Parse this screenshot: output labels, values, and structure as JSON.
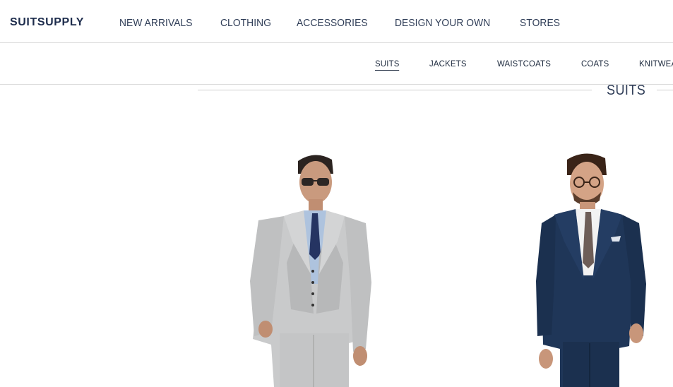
{
  "header": {
    "logo": "SUITSUPPLY",
    "nav": [
      "NEW ARRIVALS",
      "CLOTHING",
      "ACCESSORIES",
      "DESIGN YOUR OWN",
      "STORES"
    ]
  },
  "subnav": {
    "items": [
      "SUITS",
      "JACKETS",
      "WAISTCOATS",
      "COATS",
      "KNITWEA"
    ],
    "active": "SUITS"
  },
  "section": {
    "title": "SUITS"
  },
  "colors": {
    "brand": "#1d2c4c",
    "light_grey_suit": "#c9cacb",
    "navy_suit": "#1f3658"
  }
}
